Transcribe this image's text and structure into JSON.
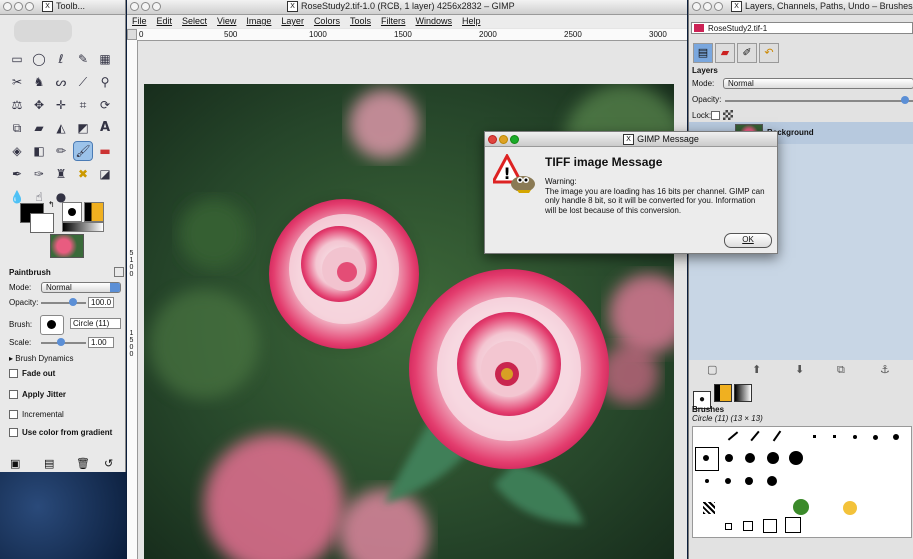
{
  "toolbox": {
    "title": "Toolb...",
    "tool_options": {
      "title": "Paintbrush",
      "mode_label": "Mode:",
      "mode_value": "Normal",
      "opacity_label": "Opacity:",
      "opacity_value": "100.0",
      "brush_label": "Brush:",
      "brush_value": "Circle (11)",
      "scale_label": "Scale:",
      "scale_value": "1.00",
      "brush_dynamics": "Brush Dynamics",
      "fade_out": "Fade out",
      "apply_jitter": "Apply Jitter",
      "incremental": "Incremental",
      "use_color_from_gradient": "Use color from gradient"
    }
  },
  "image_window": {
    "title": "RoseStudy2.tif-1.0 (RCB, 1 layer) 4256x2832 – GIMP",
    "menu": [
      "File",
      "Edit",
      "Select",
      "View",
      "Image",
      "Layer",
      "Colors",
      "Tools",
      "Filters",
      "Windows",
      "Help"
    ],
    "ruler_labels": [
      "0",
      "500",
      "1000",
      "1500",
      "2000",
      "2500",
      "3000"
    ],
    "ruler_v_labels": [
      "5",
      "1",
      "0",
      "0",
      "1",
      "5",
      "0",
      "0"
    ]
  },
  "layers_window": {
    "title": "Layers, Channels, Paths, Undo – Brushes",
    "image_selector": "RoseStudy2.tif-1",
    "layers_title": "Layers",
    "mode_label": "Mode:",
    "mode_value": "Normal",
    "opacity_label": "Opacity:",
    "lock_label": "Lock:",
    "layer_name": "Background",
    "brushes_title": "Brushes",
    "brushes_sub": "Circle (11) (13 × 13)"
  },
  "dialog": {
    "title": "GIMP Message",
    "heading": "TIFF image Message",
    "warning_label": "Warning:",
    "warning_text": "The image you are loading has 16 bits per channel. GIMP can only handle 8 bit, so it will be converted for you. Information will be lost because of this conversion.",
    "ok": "OK"
  }
}
